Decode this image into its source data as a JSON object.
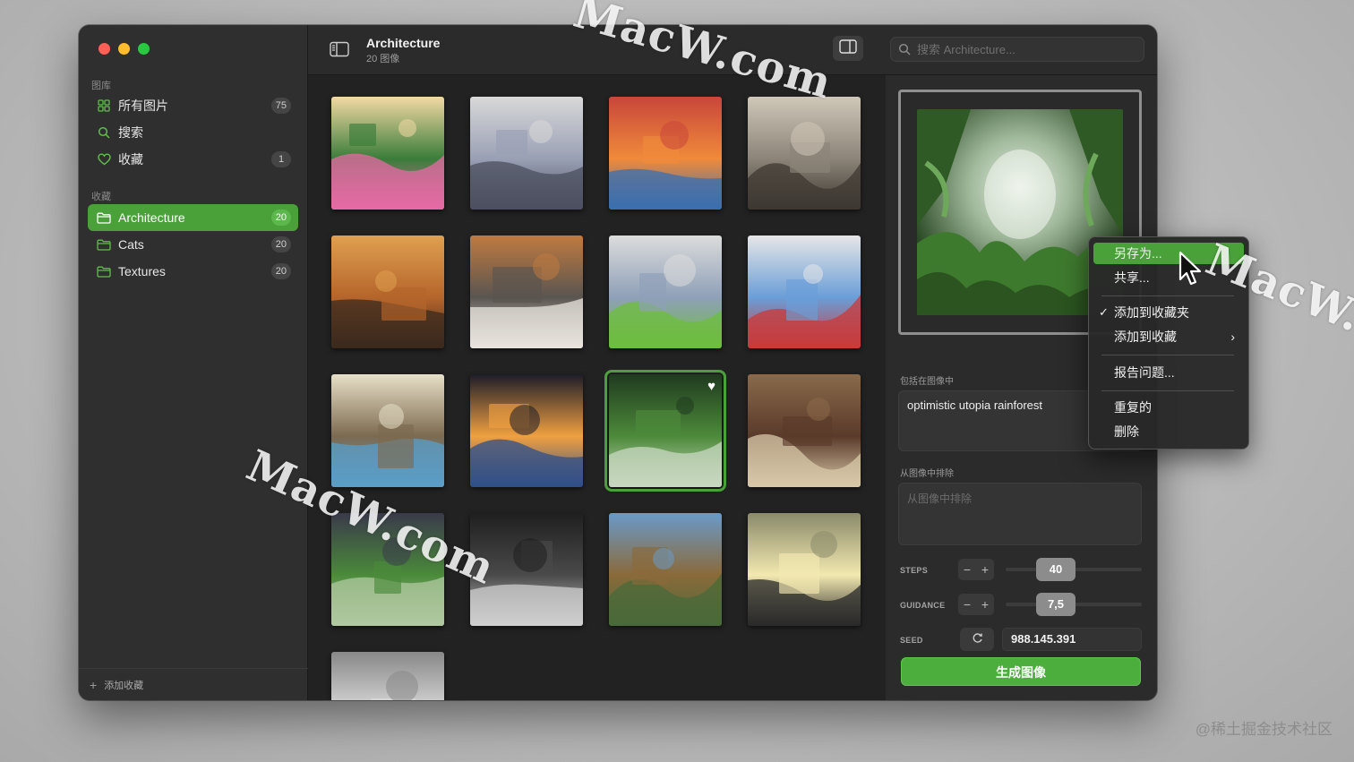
{
  "sidebar": {
    "library_label": "图库",
    "library_items": [
      {
        "label": "所有图片",
        "count": "75",
        "icon": "grid-icon"
      },
      {
        "label": "搜索",
        "count": "",
        "icon": "search-icon"
      },
      {
        "label": "收藏",
        "count": "1",
        "icon": "heart-icon"
      }
    ],
    "collections_label": "收藏",
    "collections": [
      {
        "label": "Architecture",
        "count": "20",
        "active": true,
        "icon": "folder-icon"
      },
      {
        "label": "Cats",
        "count": "20",
        "active": false,
        "icon": "folder-icon"
      },
      {
        "label": "Textures",
        "count": "20",
        "active": false,
        "icon": "folder-icon"
      }
    ],
    "add_collection_label": "添加收藏"
  },
  "toolbar": {
    "title": "Architecture",
    "subtitle": "20 图像",
    "search_placeholder": "搜索 Architecture..."
  },
  "grid": {
    "images": [
      {
        "subject": "mansion with flower garden",
        "colors": [
          "#3a7d3a",
          "#e76aa5",
          "#f3d9a4"
        ]
      },
      {
        "subject": "sketched city street",
        "colors": [
          "#9aa0b5",
          "#4b4f5f",
          "#d9d9d9"
        ]
      },
      {
        "subject": "harbor with boats",
        "colors": [
          "#f08a3a",
          "#3a6fb0",
          "#c8463a"
        ]
      },
      {
        "subject": "windmill in storm",
        "colors": [
          "#8c8478",
          "#3d3832",
          "#cfc7b8"
        ]
      },
      {
        "subject": "living room interior",
        "colors": [
          "#b5652b",
          "#3b2a1e",
          "#e0a050"
        ]
      },
      {
        "subject": "snowy cabin in forest",
        "colors": [
          "#5a5550",
          "#e8e4de",
          "#c07a40"
        ]
      },
      {
        "subject": "tiny modular house",
        "colors": [
          "#8fa0b8",
          "#6dbd3d",
          "#dcdcdc"
        ]
      },
      {
        "subject": "train station",
        "colors": [
          "#6a9ed8",
          "#c93a3a",
          "#e6e6e6"
        ]
      },
      {
        "subject": "cliffside buildings by sea",
        "colors": [
          "#7c6a50",
          "#5a9ec8",
          "#e8e0c8"
        ]
      },
      {
        "subject": "sunset waterfront",
        "colors": [
          "#f0a040",
          "#2f4f8a",
          "#1c1c28"
        ]
      },
      {
        "subject": "rainforest",
        "colors": [
          "#4d8a3a",
          "#c8d8c0",
          "#1f3a1f"
        ],
        "selected": true,
        "favorite": true
      },
      {
        "subject": "japanese house",
        "colors": [
          "#5a3a2a",
          "#d8c8a8",
          "#8a6a4a"
        ]
      },
      {
        "subject": "futuristic garden dome",
        "colors": [
          "#4a8a3a",
          "#b0c8a0",
          "#3a3a4a"
        ]
      },
      {
        "subject": "highway at night",
        "colors": [
          "#4a4a4a",
          "#cfcfcf",
          "#1f1f1f"
        ]
      },
      {
        "subject": "village on hill",
        "colors": [
          "#8a6a3a",
          "#4a6a3a",
          "#6a9ac8"
        ]
      },
      {
        "subject": "ink city drawing",
        "colors": [
          "#f2e8b0",
          "#2a2a2a",
          "#8a8a6a"
        ]
      },
      {
        "subject": "gothic church sketch",
        "colors": [
          "#dcdcdc",
          "#1f1f1f",
          "#888888"
        ]
      }
    ]
  },
  "inspector": {
    "include_label": "包括在图像中",
    "prompt": "optimistic utopia rainforest",
    "exclude_label": "从图像中排除",
    "exclude_placeholder": "从图像中排除",
    "steps_label": "STEPS",
    "steps_value": "40",
    "guidance_label": "GUIDANCE",
    "guidance_value": "7,5",
    "seed_label": "SEED",
    "seed_value": "988.145.391",
    "generate_label": "生成图像",
    "minus": "−",
    "plus": "+"
  },
  "context_menu": {
    "items": [
      {
        "label": "另存为...",
        "highlighted": true
      },
      {
        "label": "共享..."
      },
      {
        "label": "添加到收藏夹",
        "checked": true
      },
      {
        "label": "添加到收藏",
        "submenu": true
      },
      {
        "label": "报告问题..."
      },
      {
        "label": "重复的"
      },
      {
        "label": "删除"
      }
    ]
  },
  "watermarks": [
    "MacW.com",
    "MacW.com",
    "MacW.c"
  ],
  "credit": "@稀土掘金技术社区",
  "colors": {
    "accent": "#4aa13a",
    "window_bg": "#262626",
    "sidebar_bg": "#2f2f2f"
  }
}
